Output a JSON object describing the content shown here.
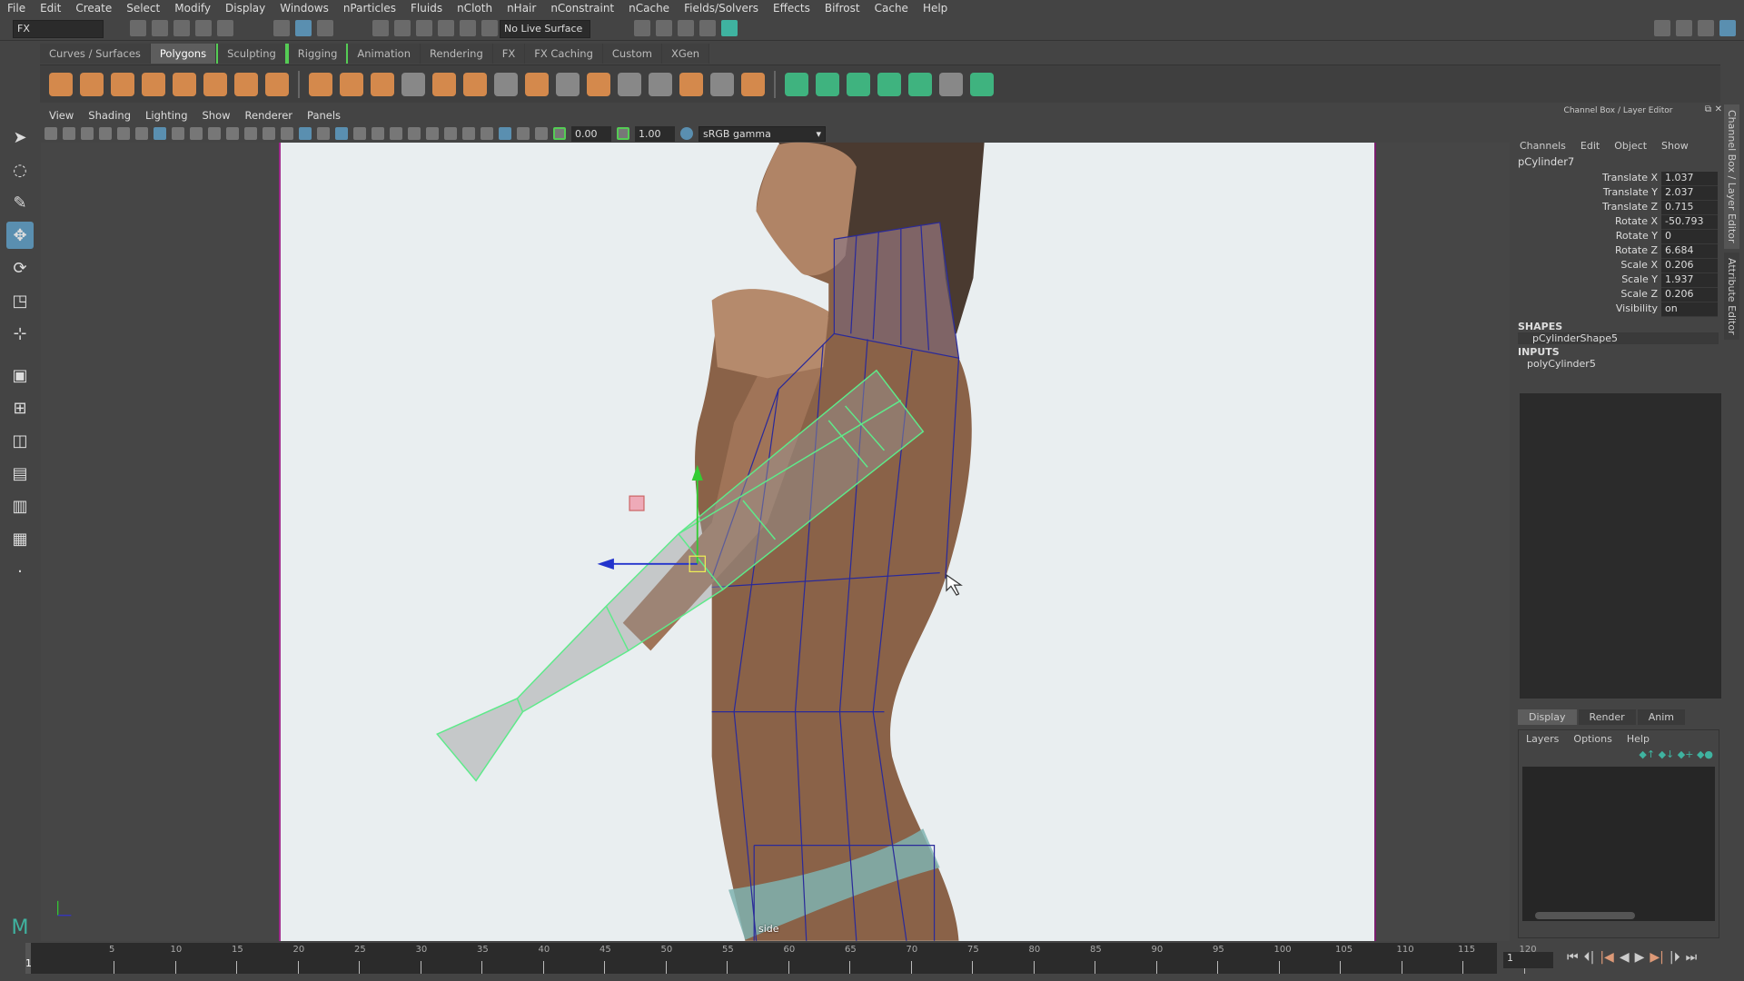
{
  "menu": [
    "File",
    "Edit",
    "Create",
    "Select",
    "Modify",
    "Display",
    "Windows",
    "nParticles",
    "Fluids",
    "nCloth",
    "nHair",
    "nConstraint",
    "nCache",
    "Fields/Solvers",
    "Effects",
    "Bifrost",
    "Cache",
    "Help"
  ],
  "status": {
    "menuset": "FX",
    "live_surface": "No Live Surface"
  },
  "shelf_tabs": [
    "Curves / Surfaces",
    "Polygons",
    "Sculpting",
    "Rigging",
    "Animation",
    "Rendering",
    "FX",
    "FX Caching",
    "Custom",
    "XGen"
  ],
  "shelf_active": "Polygons",
  "panel_menu": [
    "View",
    "Shading",
    "Lighting",
    "Show",
    "Renderer",
    "Panels"
  ],
  "panel_tools": {
    "exposure": "0.00",
    "gamma": "1.00",
    "color_space": "sRGB gamma"
  },
  "viewport": {
    "camera_label": "side"
  },
  "channel_box": {
    "title": "Channel Box / Layer Editor",
    "menu": [
      "Channels",
      "Edit",
      "Object",
      "Show"
    ],
    "object": "pCylinder7",
    "attrs": [
      {
        "name": "Translate X",
        "value": "1.037"
      },
      {
        "name": "Translate Y",
        "value": "2.037"
      },
      {
        "name": "Translate Z",
        "value": "0.715"
      },
      {
        "name": "Rotate X",
        "value": "-50.793"
      },
      {
        "name": "Rotate Y",
        "value": "0"
      },
      {
        "name": "Rotate Z",
        "value": "6.684"
      },
      {
        "name": "Scale X",
        "value": "0.206"
      },
      {
        "name": "Scale Y",
        "value": "1.937"
      },
      {
        "name": "Scale Z",
        "value": "0.206"
      },
      {
        "name": "Visibility",
        "value": "on"
      }
    ],
    "shapes_header": "SHAPES",
    "shape": "pCylinderShape5",
    "inputs_header": "INPUTS",
    "input": "polyCylinder5"
  },
  "vertical_tabs": [
    "Channel Box / Layer Editor",
    "Attribute Editor"
  ],
  "layer_editor": {
    "tabs": [
      "Display",
      "Render",
      "Anim"
    ],
    "menu": [
      "Layers",
      "Options",
      "Help"
    ]
  },
  "timeline": {
    "ticks": [
      5,
      10,
      15,
      20,
      25,
      30,
      35,
      40,
      45,
      50,
      55,
      60,
      65,
      70,
      75,
      80,
      85,
      90,
      95,
      100,
      105,
      110,
      115,
      120
    ],
    "current_frame": "1",
    "range_field": "1"
  },
  "colors": {
    "accent": "#5a8fb0",
    "mesh_wire": "#2a2a9a",
    "selected_wire": "#5eea8a",
    "shelf_orange": "#d4894c",
    "shelf_green": "#3fb37f"
  }
}
